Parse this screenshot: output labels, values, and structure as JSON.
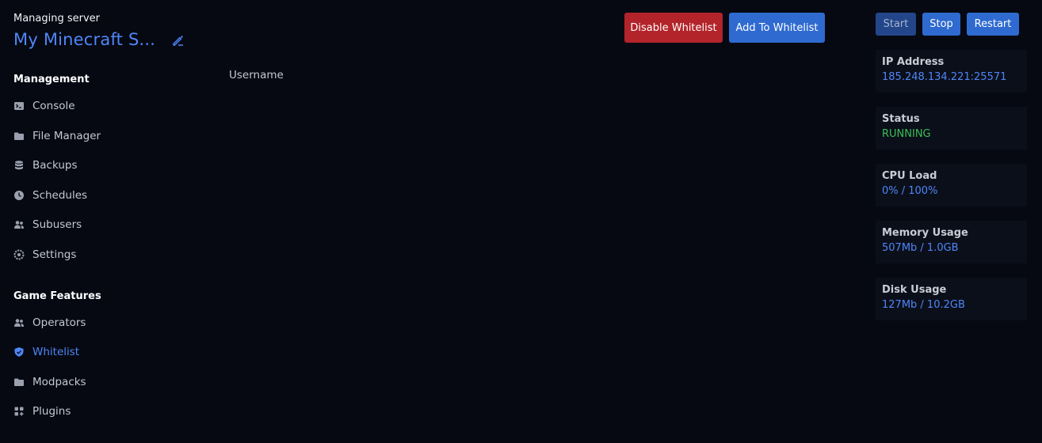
{
  "header": {
    "managing_label": "Managing server",
    "server_name": "My Minecraft S..."
  },
  "sidebar": {
    "management_title": "Management",
    "management_items": [
      {
        "label": "Console",
        "icon": "terminal-icon"
      },
      {
        "label": "File Manager",
        "icon": "folder-icon"
      },
      {
        "label": "Backups",
        "icon": "database-icon"
      },
      {
        "label": "Schedules",
        "icon": "clock-icon"
      },
      {
        "label": "Subusers",
        "icon": "users-icon"
      },
      {
        "label": "Settings",
        "icon": "gear-icon"
      }
    ],
    "game_title": "Game Features",
    "game_items": [
      {
        "label": "Operators",
        "icon": "users-icon"
      },
      {
        "label": "Whitelist",
        "icon": "shield-icon",
        "active": true
      },
      {
        "label": "Modpacks",
        "icon": "folder-icon"
      },
      {
        "label": "Plugins",
        "icon": "puzzle-icon"
      }
    ]
  },
  "main": {
    "column_header": "Username",
    "disable_whitelist_label": "Disable Whitelist",
    "add_whitelist_label": "Add To Whitelist"
  },
  "power": {
    "start_label": "Start",
    "stop_label": "Stop",
    "restart_label": "Restart"
  },
  "stats": [
    {
      "label": "IP Address",
      "value": "185.248.134.221:25571"
    },
    {
      "label": "Status",
      "value": "RUNNING"
    },
    {
      "label": "CPU Load",
      "value": "0% / 100%"
    },
    {
      "label": "Memory Usage",
      "value": "507Mb / 1.0GB"
    },
    {
      "label": "Disk Usage",
      "value": "127Mb / 10.2GB"
    }
  ],
  "colors": {
    "background": "#060912",
    "accent": "#4f86f7",
    "danger": "#b3242a",
    "primary_button": "#2f6ad0",
    "running": "#3bbf55"
  }
}
